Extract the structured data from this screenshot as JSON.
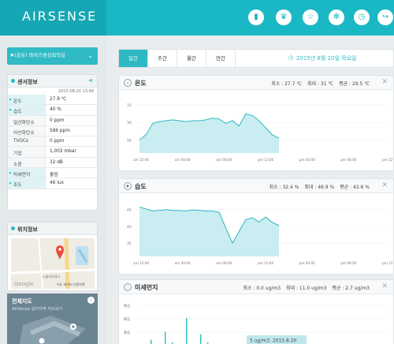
{
  "header": {
    "logo": "AIRSENSE",
    "icons": [
      "bar-chart-icon",
      "trophy-icon",
      "star-icon",
      "gear-icon",
      "alarm-clock-icon",
      "logout-icon"
    ]
  },
  "sidebar": {
    "site_label": "(공유) 와이즈센싱회의실",
    "sensor_panel": {
      "title": "센서정보",
      "timestamp": "2015-08-20 13:48",
      "rows": [
        {
          "label": "온도",
          "value": "27.9 ℃",
          "highlight": true
        },
        {
          "label": "습도",
          "value": "40 %",
          "highlight": true
        },
        {
          "label": "일산화탄소",
          "value": "0 ppm",
          "highlight": false
        },
        {
          "label": "이산화탄소",
          "value": "586 ppm",
          "highlight": false
        },
        {
          "label": "TVOCs",
          "value": "0 ppm",
          "highlight": false
        },
        {
          "label": "기압",
          "value": "1,003 mbar",
          "highlight": false
        },
        {
          "label": "소음",
          "value": "32 dB",
          "highlight": false
        },
        {
          "label": "미세먼지",
          "value": "좋음",
          "highlight": true
        },
        {
          "label": "조도",
          "value": "46 lux",
          "highlight": true
        }
      ]
    },
    "location_panel": {
      "title": "위치정보",
      "map_footer": "지도 데이터  이용약관",
      "map_logo": "Google",
      "map_place": "노블하이테크"
    },
    "whole_map": {
      "title": "전체지도",
      "subtitle": "AirSense 설치지역 지도보기"
    }
  },
  "main": {
    "tabs": [
      {
        "label": "일간",
        "active": true
      },
      {
        "label": "주간",
        "active": false
      },
      {
        "label": "월간",
        "active": false
      },
      {
        "label": "연간",
        "active": false
      }
    ],
    "date": "2015년 8월 20일 목요일",
    "cards": [
      {
        "title": "온도",
        "icon": "thermometer-icon",
        "min": "최소 : 27.7 ℃",
        "max": "최대 : 31 ℃",
        "avg": "평균 : 29.5 ℃"
      },
      {
        "title": "습도",
        "icon": "water-drop-icon",
        "min": "최소 : 32.4 %",
        "max": "최대 : 46.9 %",
        "avg": "평균 : 42.6 %"
      },
      {
        "title": "미세먼지",
        "icon": "dust-icon",
        "min": "최소 : 0.0 ug/m3",
        "max": "최대 : 11.0 ug/m3",
        "avg": "평균 : 2.7 ug/m3"
      }
    ],
    "dust_tooltip": "5 ug/m3, 2015.8.20"
  },
  "chart_data": [
    {
      "type": "area",
      "title": "온도",
      "x": [
        "am 12:00",
        "am 04:00",
        "am 08:00",
        "pm 12:00",
        "pm 04:00",
        "pm 08:00",
        "pm 12:00"
      ],
      "yticks": [
        28,
        30,
        32
      ],
      "ylim": [
        26.5,
        33
      ],
      "series": [
        {
          "values": [
            28,
            28.6,
            29.9,
            30.1,
            30.2,
            30.3,
            30.2,
            30.1,
            30.2,
            30.2,
            30.3,
            30.5,
            30.4,
            29.9,
            30.2,
            29.6,
            31.0,
            30.8,
            30.2,
            29.4,
            28.6,
            28.2
          ]
        }
      ],
      "color": "#2cb9c4"
    },
    {
      "type": "area",
      "title": "습도",
      "x": [
        "am 12:00",
        "am 04:00",
        "am 08:00",
        "pm 12:00",
        "pm 04:00",
        "pm 08:00",
        "pm 12:00"
      ],
      "yticks": [
        35,
        40,
        45
      ],
      "ylim": [
        31,
        48
      ],
      "series": [
        {
          "values": [
            45.8,
            45.2,
            44.6,
            44.8,
            45.0,
            44.8,
            44.7,
            44.6,
            44.9,
            44.8,
            44.6,
            44.6,
            44.2,
            39.5,
            35.0,
            38.5,
            42.0,
            42.6,
            41.3,
            42.8,
            41.2,
            40.2
          ]
        }
      ],
      "color": "#2cb9c4"
    },
    {
      "type": "bar",
      "title": "미세먼지",
      "yticks": [
        "좋음",
        "좋음",
        "좋음"
      ],
      "series": [
        {
          "values": [
            0,
            0,
            3,
            0,
            6,
            2,
            0,
            11,
            0,
            5,
            2,
            0,
            0,
            0
          ]
        }
      ],
      "color": "#2cb9c4"
    }
  ]
}
